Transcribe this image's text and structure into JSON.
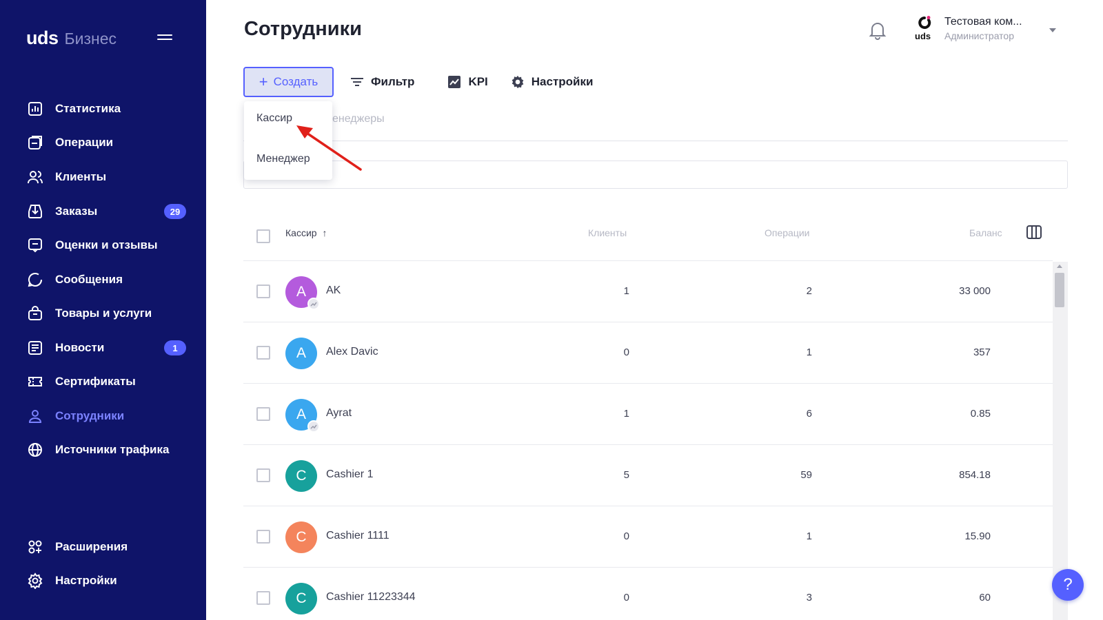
{
  "brand": {
    "logo": "uds",
    "product": "Бизнес"
  },
  "sidebar": {
    "items": [
      {
        "label": "Статистика",
        "icon": "chart-icon"
      },
      {
        "label": "Операции",
        "icon": "operations-icon"
      },
      {
        "label": "Клиенты",
        "icon": "clients-icon"
      },
      {
        "label": "Заказы",
        "icon": "orders-icon",
        "badge": "29"
      },
      {
        "label": "Оценки и отзывы",
        "icon": "reviews-icon"
      },
      {
        "label": "Сообщения",
        "icon": "messages-icon"
      },
      {
        "label": "Товары и услуги",
        "icon": "goods-icon"
      },
      {
        "label": "Новости",
        "icon": "news-icon",
        "badge": "1"
      },
      {
        "label": "Сертификаты",
        "icon": "certificates-icon"
      },
      {
        "label": "Сотрудники",
        "icon": "employees-icon",
        "active": true
      },
      {
        "label": "Источники трафика",
        "icon": "globe-icon"
      }
    ],
    "bottom": [
      {
        "label": "Расширения",
        "icon": "extensions-icon"
      },
      {
        "label": "Настройки",
        "icon": "gear-icon"
      }
    ]
  },
  "header": {
    "title": "Сотрудники",
    "company_name": "Тестовая ком...",
    "company_role": "Администратор",
    "company_logo": "uds"
  },
  "toolbar": {
    "create_label": "Создать",
    "filter_label": "Фильтр",
    "kpi_label": "KPI",
    "settings_label": "Настройки"
  },
  "tabs": {
    "ghost_label": "енеджеры"
  },
  "dropdown": {
    "items": [
      "Кассир",
      "Менеджер"
    ]
  },
  "table": {
    "columns": [
      "Кассир",
      "Клиенты",
      "Операции",
      "Баланс"
    ],
    "sort_indicator": "↑",
    "rows": [
      {
        "initial": "A",
        "name": "AK",
        "clients": "1",
        "operations": "2",
        "balance": "33 000",
        "avatar_color": "#b45bdd",
        "sub_badge": true
      },
      {
        "initial": "A",
        "name": "Alex Davic",
        "clients": "0",
        "operations": "1",
        "balance": "357",
        "avatar_color": "#3aa7ef",
        "sub_badge": false
      },
      {
        "initial": "A",
        "name": "Ayrat",
        "clients": "1",
        "operations": "6",
        "balance": "0.85",
        "avatar_color": "#3aa7ef",
        "sub_badge": true
      },
      {
        "initial": "C",
        "name": "Cashier 1",
        "clients": "5",
        "operations": "59",
        "balance": "854.18",
        "avatar_color": "#17a19c",
        "sub_badge": false
      },
      {
        "initial": "C",
        "name": "Cashier 1111",
        "clients": "0",
        "operations": "1",
        "balance": "15.90",
        "avatar_color": "#f4845c",
        "sub_badge": false
      },
      {
        "initial": "C",
        "name": "Cashier 11223344",
        "clients": "0",
        "operations": "3",
        "balance": "60",
        "avatar_color": "#17a19c",
        "sub_badge": false
      }
    ]
  },
  "help": {
    "label": "?"
  },
  "colors": {
    "sidebar_bg": "#0f1469",
    "accent": "#5560ff",
    "active_nav": "#7b82ff"
  }
}
